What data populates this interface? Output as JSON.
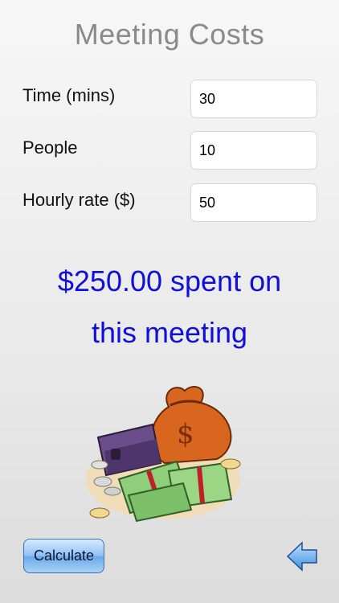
{
  "header": {
    "title": "Meeting Costs"
  },
  "form": {
    "time": {
      "label": "Time (mins)",
      "value": "30"
    },
    "people": {
      "label": "People",
      "value": "10"
    },
    "rate": {
      "label": "Hourly rate ($)",
      "value": "50"
    }
  },
  "result": {
    "line1": "$250.00 spent on",
    "line2": "this meeting"
  },
  "illustration": {
    "icon": "money-wallet-illustration",
    "bag_mark": "$"
  },
  "footer": {
    "calculate_label": "Calculate",
    "back_icon": "back-arrow-icon"
  },
  "colors": {
    "result_text": "#1010d8",
    "title_text": "#8a8a8a",
    "button": "#8ec0f2"
  }
}
